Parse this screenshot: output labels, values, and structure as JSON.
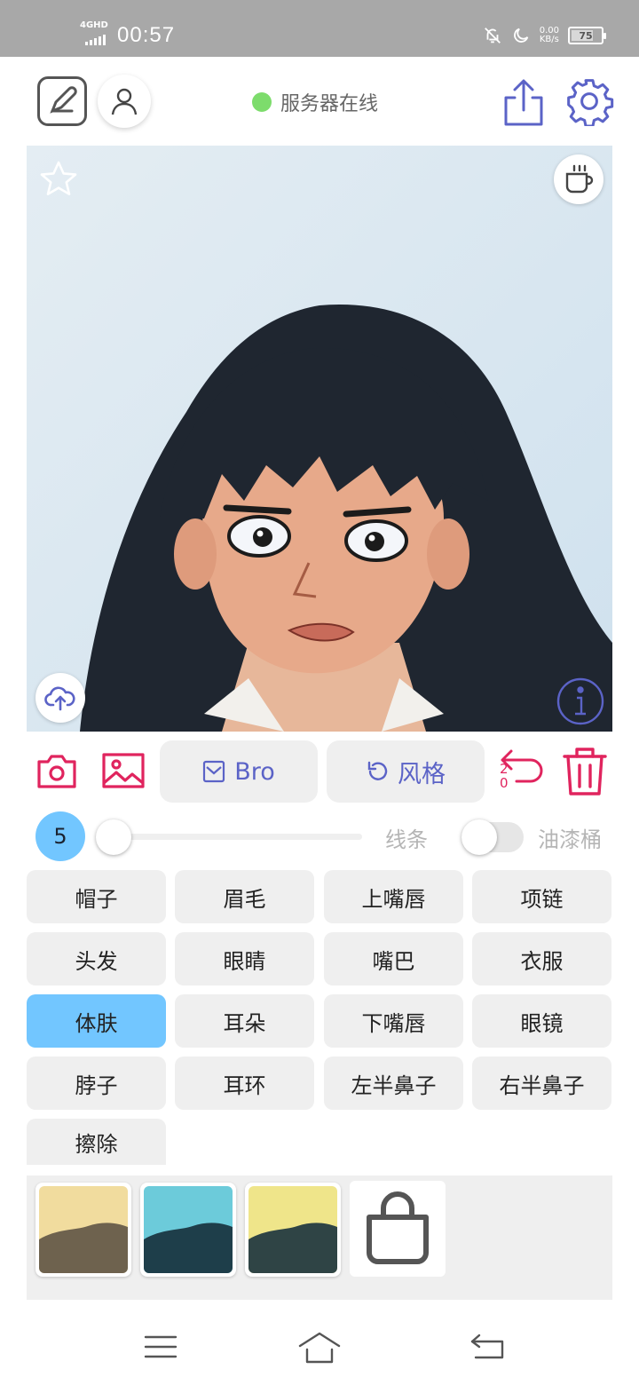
{
  "status_bar": {
    "network": "4GHD",
    "time": "00:57",
    "speed_value": "0.00",
    "speed_unit": "KB/s",
    "battery": "75",
    "battery_level": 0.75
  },
  "toolbar": {
    "server_status": "服务器在线",
    "server_color": "#7ddc6c",
    "icons": [
      "edit-icon",
      "user-icon",
      "share-icon",
      "gear-icon"
    ],
    "accent": "#5b63c7"
  },
  "canvas": {
    "icons": [
      "star-icon",
      "coffee-icon",
      "cloud-upload-icon",
      "info-icon"
    ]
  },
  "actions": {
    "bro_label": "Bro",
    "style_label": "风格",
    "undo_count_top": "2",
    "undo_count_bottom": "0",
    "action_color": "#e0245e"
  },
  "brush": {
    "size": "5",
    "size_fraction": 0.0,
    "line_label": "线条",
    "line_toggle_on": false,
    "bucket_label": "油漆桶"
  },
  "parts": [
    {
      "label": "帽子",
      "active": false
    },
    {
      "label": "眉毛",
      "active": false
    },
    {
      "label": "上嘴唇",
      "active": false
    },
    {
      "label": "项链",
      "active": false
    },
    {
      "label": "头发",
      "active": false
    },
    {
      "label": "眼睛",
      "active": false
    },
    {
      "label": "嘴巴",
      "active": false
    },
    {
      "label": "衣服",
      "active": false
    },
    {
      "label": "体肤",
      "active": true
    },
    {
      "label": "耳朵",
      "active": false
    },
    {
      "label": "下嘴唇",
      "active": false
    },
    {
      "label": "眼镜",
      "active": false
    },
    {
      "label": "脖子",
      "active": false
    },
    {
      "label": "耳环",
      "active": false
    },
    {
      "label": "左半鼻子",
      "active": false
    },
    {
      "label": "右半鼻子",
      "active": false
    },
    {
      "label": "擦除",
      "active": false
    }
  ],
  "palette": {
    "swatches": [
      {
        "top": "#f1dc9e",
        "bottom": "#6e624e"
      },
      {
        "top": "#6ccbda",
        "bottom": "#1e3e4a"
      },
      {
        "top": "#efe58a",
        "bottom": "#2f4445"
      }
    ],
    "store_icon": "shopping-bag-icon"
  },
  "navbar": {
    "icons": [
      "menu-icon",
      "home-icon",
      "back-icon"
    ]
  }
}
